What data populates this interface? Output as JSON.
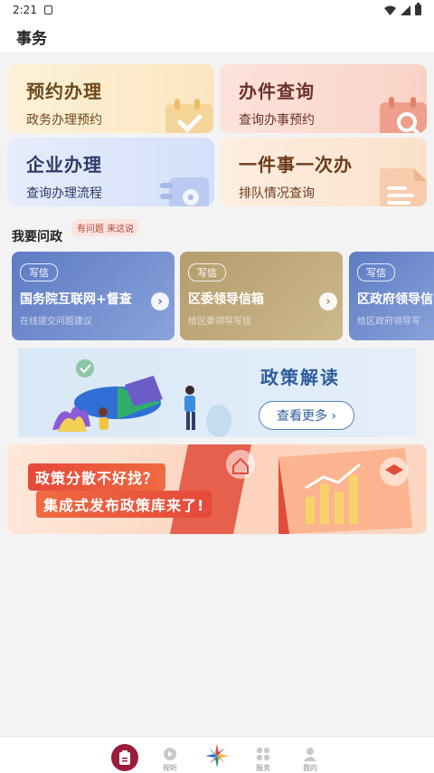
{
  "status": {
    "time": "2:21"
  },
  "header": {
    "title": "事务"
  },
  "services": [
    {
      "title": "预约办理",
      "subtitle": "政务办理预约"
    },
    {
      "title": "办件查询",
      "subtitle": "查询办事预约"
    },
    {
      "title": "企业办理",
      "subtitle": "查询办理流程"
    },
    {
      "title": "一件事一次办",
      "subtitle": "排队情况查询"
    }
  ],
  "ask": {
    "title": "我要问政",
    "badge": "有问题 来这说",
    "letters": [
      {
        "tag": "写信",
        "title": "国务院互联网+督查",
        "subtitle": "在线提交问题建议"
      },
      {
        "tag": "写信",
        "title": "区委领导信箱",
        "subtitle": "给区委领导写信"
      },
      {
        "tag": "写信",
        "title": "区政府领导信",
        "subtitle": "给区政府领导写"
      }
    ]
  },
  "policy_banner": {
    "title": "政策解读",
    "button": "查看更多 ›"
  },
  "promo_banner": {
    "line1": "政策分散不好找？",
    "line2": "集成式发布政策库来了!"
  },
  "tabs": [
    {
      "label": ""
    },
    {
      "label": "视听"
    },
    {
      "label": ""
    },
    {
      "label": "服务"
    },
    {
      "label": "我的"
    }
  ],
  "colors": {
    "accent": "#9b1b3a",
    "policy_blue": "#2e5d9c",
    "promo_red": "#e5493a"
  }
}
